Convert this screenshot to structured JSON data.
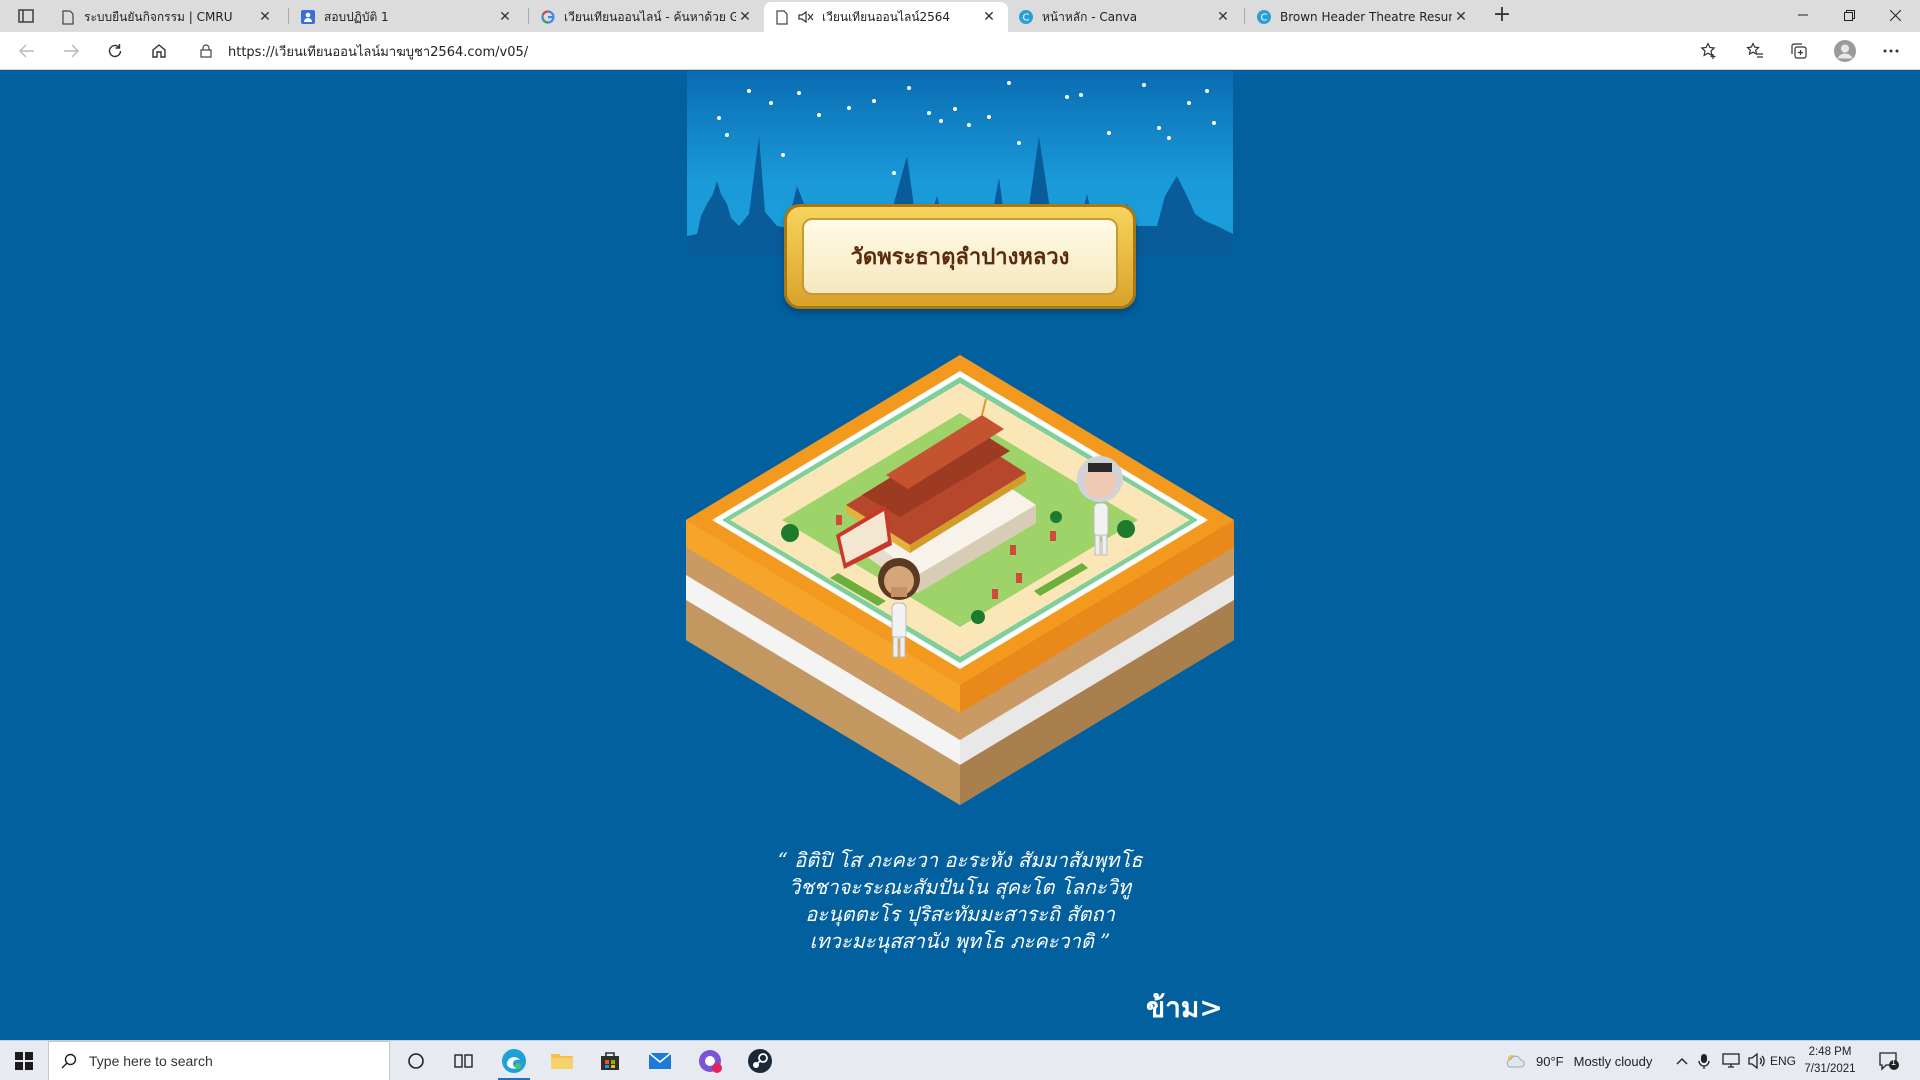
{
  "browser": {
    "tabs": [
      {
        "title": "ระบบยืนยันกิจกรรม | CMRU",
        "icon": "page-icon"
      },
      {
        "title": "สอบปฏิบัติ 1",
        "icon": "forms-icon"
      },
      {
        "title": "เวียนเทียนออนไลน์ - ค้นหาด้วย Goog",
        "icon": "google-icon"
      },
      {
        "title": "เวียนเทียนออนไลน์2564",
        "icon": "page-icon",
        "active": true,
        "muted": true
      },
      {
        "title": "หน้าหลัก - Canva",
        "icon": "canva-icon"
      },
      {
        "title": "Brown Header Theatre Resume -",
        "icon": "canva-icon"
      }
    ],
    "url": "https://เวียนเทียนออนไลน์มาฆบูชา2564.com/v05/"
  },
  "page": {
    "plaque_title": "วัดพระธาตุลำปางหลวง",
    "chant_lines": [
      "“ อิติปิ โส ภะคะวา อะระหัง สัมมาสัมพุทโธ",
      "วิชชาจะระณะสัมปันโน สุคะโต โลกะวิทู",
      "อะนุตตะโร ปุริสะทัมมะสาระถิ สัตถา",
      "เทวะมะนุสสานัง พุทโธ ภะคะวาติ ”"
    ],
    "skip_label": "ข้าม>"
  },
  "taskbar": {
    "search_placeholder": "Type here to search",
    "weather_temp": "90°F",
    "weather_desc": "Mostly cloudy",
    "language": "ENG",
    "time": "2:48 PM",
    "date": "7/31/2021",
    "notification_count": "1"
  },
  "colors": {
    "page_bg": "#02609f",
    "banner_sky": "#1a9ad8",
    "plaque_gold": "#e6b73c",
    "platform_orange": "#f39a1e"
  }
}
